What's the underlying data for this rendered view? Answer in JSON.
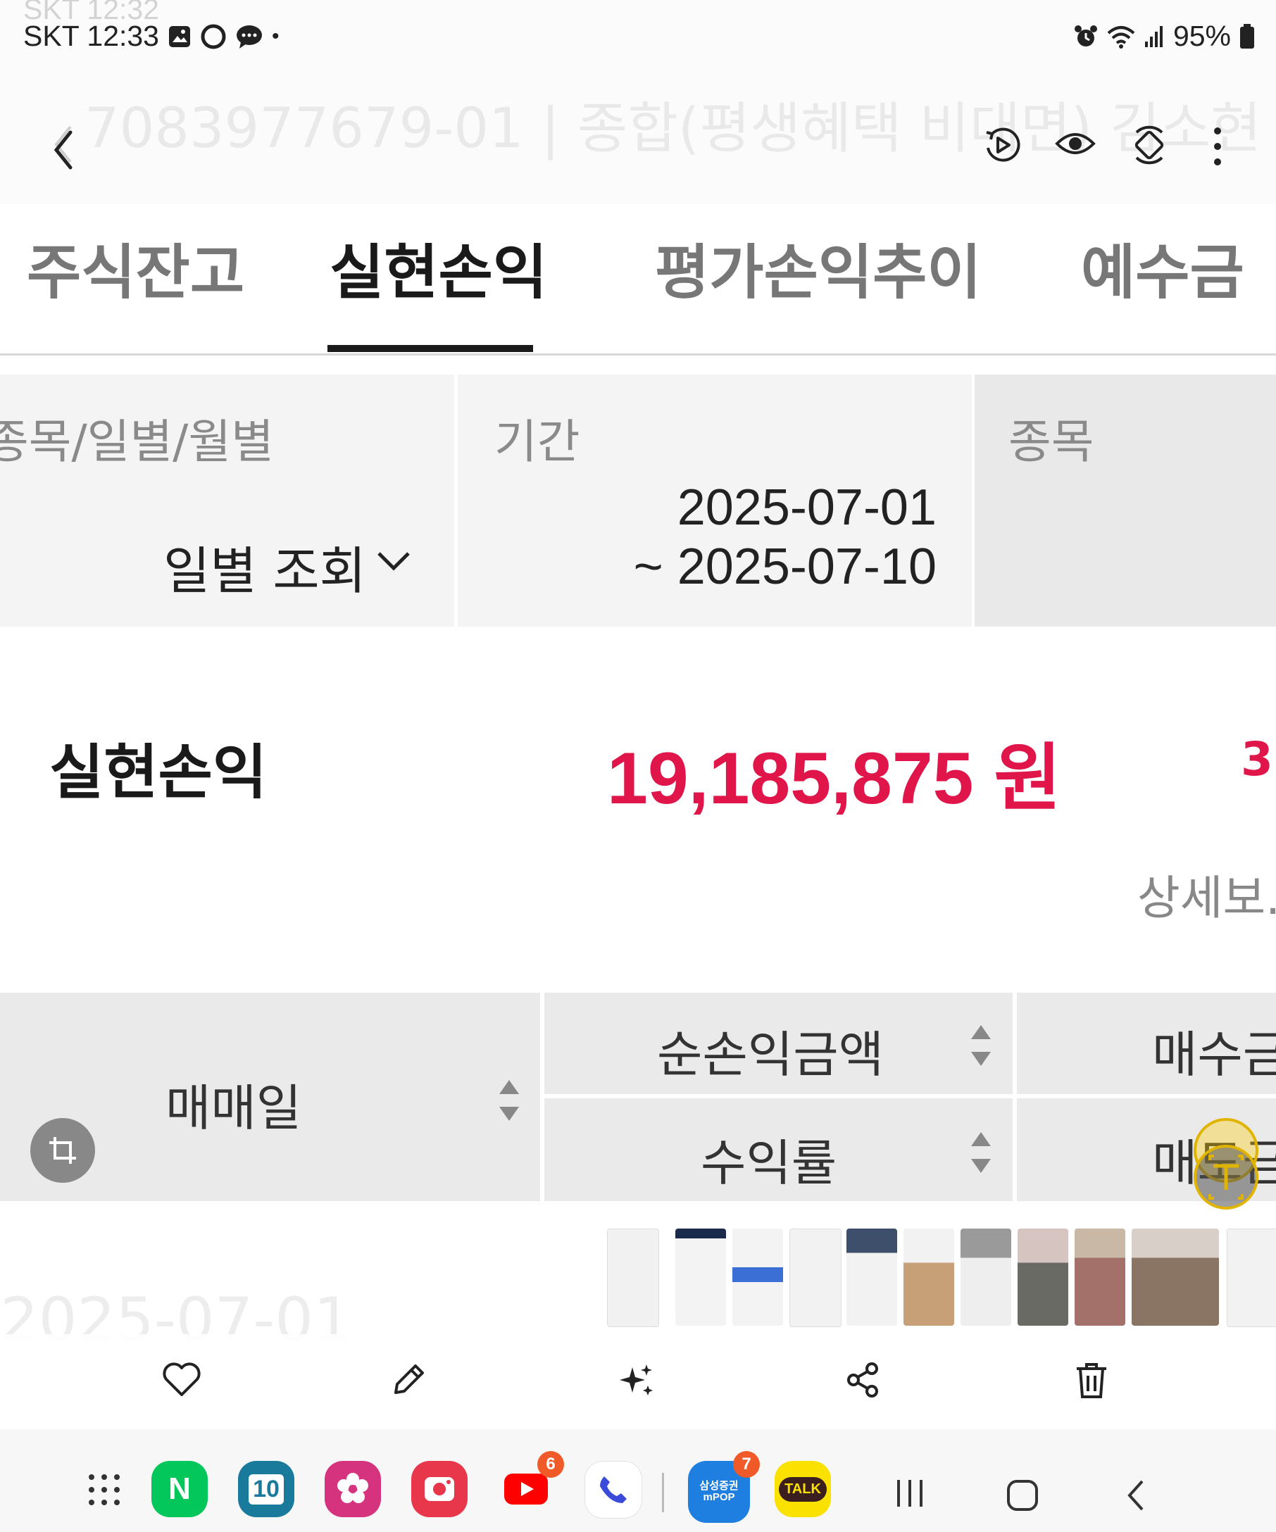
{
  "status": {
    "carrier_time": "SKT 12:33",
    "ghost_carrier_time": "SKT 12:32",
    "battery": "95%"
  },
  "appbar": {
    "ghost_title": "7083977679-01 | 종합(평생혜택 비대면) 김소현"
  },
  "tabs": [
    {
      "label": "주식잔고",
      "active": false
    },
    {
      "label": "실현손익",
      "active": true
    },
    {
      "label": "평가손익추이",
      "active": false
    },
    {
      "label": "예수금",
      "active": false
    }
  ],
  "filter": {
    "type_label": "종목/일별/월별",
    "type_value": "일별 조회",
    "period_label": "기간",
    "period_start": "2025-07-01",
    "period_end": "~ 2025-07-10",
    "stock_label": "종목"
  },
  "summary": {
    "label": "실현손익",
    "value": "19,185,875 원",
    "rate": "3.",
    "detail_link": "상세보."
  },
  "table": {
    "date_header": "매매일",
    "net_profit_header": "순손익금액",
    "return_rate_header": "수익률",
    "buy_amount_header": "매수금",
    "sell_amount_header": "매도금"
  },
  "row_ghost": "2025-07-01",
  "dock": {
    "apps": [
      {
        "name": "naver",
        "label": "N",
        "color": "#03c75a"
      },
      {
        "name": "calendar",
        "label": "10",
        "color": "#1a7a9c"
      },
      {
        "name": "gallery",
        "label": "",
        "color": "#d6337f"
      },
      {
        "name": "screen-recorder",
        "label": "",
        "color": "#e8364a"
      },
      {
        "name": "youtube",
        "label": "",
        "color": "#ffffff",
        "badge": "6"
      },
      {
        "name": "phone",
        "label": "",
        "color": "#ffffff"
      },
      {
        "name": "samsung-pop",
        "label": "삼성증권 mPOP",
        "color": "#1e7fe0",
        "badge": "7"
      },
      {
        "name": "kakaotalk",
        "label": "TALK",
        "color": "#fae100"
      }
    ]
  },
  "colors": {
    "accent_red": "#e0164b",
    "tab_active": "#1a1a1a",
    "tab_inactive": "#777777",
    "header_bg": "#eaeaea"
  }
}
